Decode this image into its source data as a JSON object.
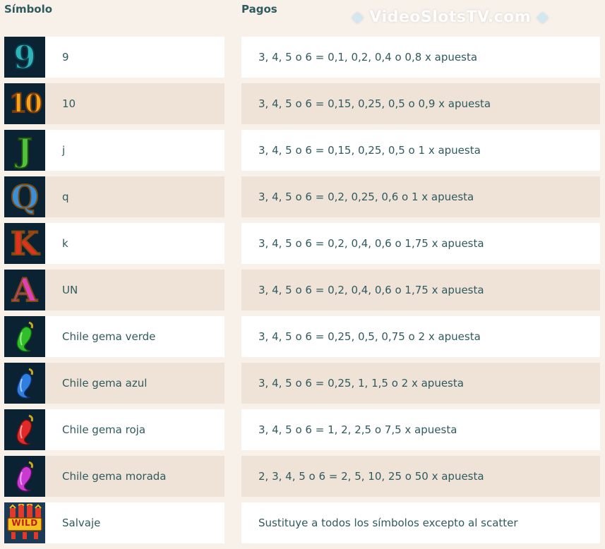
{
  "header": {
    "symbol_label": "Símbolo",
    "pays_label": "Pagos"
  },
  "watermark": {
    "text_a": "Video",
    "text_b": "Slots",
    "text_c": "TV",
    "text_d": ".com"
  },
  "rows": [
    {
      "name": "9",
      "icon": "nine-icon",
      "pay": "3, 4, 5 o 6 = 0,1, 0,2, 0,4 o 0,8 x apuesta"
    },
    {
      "name": "10",
      "icon": "ten-icon",
      "pay": "3, 4, 5 o 6 = 0,15, 0,25, 0,5 o 0,9 x apuesta"
    },
    {
      "name": "j",
      "icon": "jack-icon",
      "pay": "3, 4, 5 o 6 = 0,15, 0,25, 0,5 o 1 x apuesta"
    },
    {
      "name": "q",
      "icon": "queen-icon",
      "pay": "3, 4, 5 o 6 = 0,2, 0,25, 0,6 o 1 x apuesta"
    },
    {
      "name": "k",
      "icon": "king-icon",
      "pay": "3, 4, 5 o 6 = 0,2, 0,4, 0,6 o 1,75 x apuesta"
    },
    {
      "name": "UN",
      "icon": "ace-icon",
      "pay": "3, 4, 5 o 6 = 0,2, 0,4, 0,6 o 1,75 x apuesta"
    },
    {
      "name": "Chile gema verde",
      "icon": "green-chili-gem-icon",
      "pay": "3, 4, 5 o 6 = 0,25, 0,5, 0,75 o 2 x apuesta"
    },
    {
      "name": "Chile gema azul",
      "icon": "blue-chili-gem-icon",
      "pay": "3, 4, 5 o 6 = 0,25, 1, 1,5 o 2 x apuesta"
    },
    {
      "name": "Chile gema roja",
      "icon": "red-chili-gem-icon",
      "pay": "3, 4, 5 o 6 = 1, 2, 2,5 o 7,5 x apuesta"
    },
    {
      "name": "Chile gema morada",
      "icon": "purple-chili-gem-icon",
      "pay": "2, 3, 4, 5 o 6 = 2, 5, 10, 25 o 50 x apuesta"
    },
    {
      "name": "Salvaje",
      "icon": "wild-icon",
      "pay": "Sustituye a todos los símbolos excepto al scatter"
    }
  ],
  "icon_glyphs": {
    "nine": "9",
    "ten": "10",
    "jack": "J",
    "queen": "Q",
    "king": "K",
    "ace": "A",
    "wild": "WILD"
  },
  "colors": {
    "text": "#2f5a5e",
    "row_light": "#ffffff",
    "row_dark": "#efe3d8",
    "background": "#f7f1ea"
  }
}
